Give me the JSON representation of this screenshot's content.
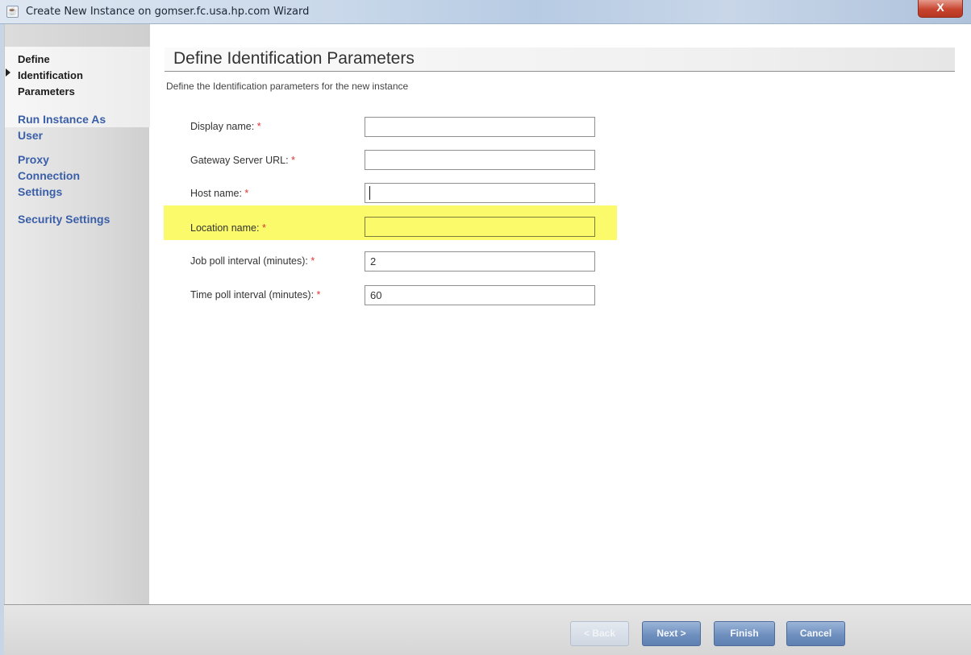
{
  "window": {
    "title": "Create New Instance on gomser.fc.usa.hp.com Wizard",
    "close_label": "X"
  },
  "sidebar": {
    "items": [
      {
        "label": "Define Identification Parameters",
        "line1": "Define",
        "line2": "Identification",
        "line3": "Parameters",
        "current": true
      },
      {
        "label": "Run Instance As User",
        "line1": "Run Instance As",
        "line2": "User"
      },
      {
        "label": "Proxy Connection Settings",
        "line1": "Proxy",
        "line2": "Connection",
        "line3": "Settings"
      },
      {
        "label": "Security Settings",
        "line1": "Security Settings"
      }
    ]
  },
  "page": {
    "title": "Define Identification Parameters",
    "subtitle": "Define the Identification parameters for the new instance"
  },
  "form": {
    "required_marker": "*",
    "fields": [
      {
        "label": "Display name:",
        "value": ""
      },
      {
        "label": "Gateway Server URL:",
        "value": ""
      },
      {
        "label": "Host name:",
        "value": ""
      },
      {
        "label": "Location name:",
        "value": "",
        "highlighted": true
      },
      {
        "label": "Job poll interval (minutes):",
        "value": "2"
      },
      {
        "label": "Time poll interval (minutes):",
        "value": "60"
      }
    ]
  },
  "buttons": {
    "back": "< Back",
    "next": "Next >",
    "finish": "Finish",
    "cancel": "Cancel"
  },
  "colors": {
    "highlight": "#fafa6a",
    "link": "#3a5fa8",
    "required": "#dd3333",
    "button": "#6f90bf"
  }
}
